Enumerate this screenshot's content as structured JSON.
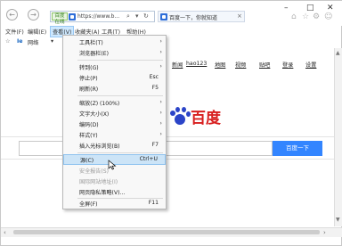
{
  "colors": {
    "accent": "#3385ff",
    "menu_highlight": "#cce4f7",
    "baidu_red": "#d81e1e",
    "baidu_blue": "#2b44c8",
    "cert_green": "#e9f5e1"
  },
  "nav": {
    "back_icon": "back-arrow-icon",
    "forward_icon": "forward-arrow-icon"
  },
  "address_bar": {
    "cert_label": "百度在线",
    "url": "https://www.b...",
    "search_icon": "search-icon",
    "refresh_icon": "refresh-icon",
    "dropdown_icon": "chevron-down-icon"
  },
  "tab": {
    "title": "百度一下，你就知道",
    "close": "×"
  },
  "window_controls": {
    "minimize": "–",
    "maximize": "□",
    "close": "✕"
  },
  "right_icons": {
    "home": "⌂",
    "favorites": "☆",
    "settings": "⚙",
    "smiley": "☺"
  },
  "menubar": {
    "items": [
      {
        "label": "文件(F)"
      },
      {
        "label": "编辑(E)"
      },
      {
        "label": "查看(V)"
      },
      {
        "label": "收藏夹(A)"
      },
      {
        "label": "工具(T)"
      },
      {
        "label": "帮助(H)"
      }
    ]
  },
  "favorites_bar": {
    "star": "☆",
    "fav_icon_label": "Ie",
    "label": "网络"
  },
  "page": {
    "links": [
      "新闻",
      "hao123",
      "地图",
      "视频",
      "贴吧",
      "登录",
      "设置"
    ],
    "logo_text": "百度",
    "search_button": "百度一下",
    "search_value": ""
  },
  "dropdown": {
    "items": [
      {
        "label": "工具栏(T)",
        "shortcut": "",
        "arrow": true,
        "disabled": false,
        "highlight": false
      },
      {
        "label": "浏览器栏(E)",
        "shortcut": "",
        "arrow": true,
        "disabled": false,
        "highlight": false
      },
      {
        "label": "转到(G)",
        "shortcut": "",
        "arrow": true,
        "disabled": false,
        "highlight": false
      },
      {
        "label": "停止(P)",
        "shortcut": "Esc",
        "arrow": false,
        "disabled": false,
        "highlight": false
      },
      {
        "label": "刷新(R)",
        "shortcut": "F5",
        "arrow": false,
        "disabled": false,
        "highlight": false
      },
      {
        "label": "缩放(Z) (100%)",
        "shortcut": "",
        "arrow": true,
        "disabled": false,
        "highlight": false
      },
      {
        "label": "文字大小(X)",
        "shortcut": "",
        "arrow": true,
        "disabled": false,
        "highlight": false
      },
      {
        "label": "编码(D)",
        "shortcut": "",
        "arrow": true,
        "disabled": false,
        "highlight": false
      },
      {
        "label": "样式(Y)",
        "shortcut": "",
        "arrow": true,
        "disabled": false,
        "highlight": false
      },
      {
        "label": "插入光标浏览(B)",
        "shortcut": "F7",
        "arrow": false,
        "disabled": false,
        "highlight": false
      },
      {
        "label": "源(C)",
        "shortcut": "Ctrl+U",
        "arrow": false,
        "disabled": false,
        "highlight": true
      },
      {
        "label": "安全报告(S)",
        "shortcut": "",
        "arrow": false,
        "disabled": true,
        "highlight": false
      },
      {
        "label": "国际网站地址(I)",
        "shortcut": "",
        "arrow": false,
        "disabled": true,
        "highlight": false
      },
      {
        "label": "网页隐私策略(V)...",
        "shortcut": "",
        "arrow": false,
        "disabled": false,
        "highlight": false
      },
      {
        "label": "全屏(F)",
        "shortcut": "F11",
        "arrow": false,
        "disabled": false,
        "highlight": false
      }
    ]
  }
}
